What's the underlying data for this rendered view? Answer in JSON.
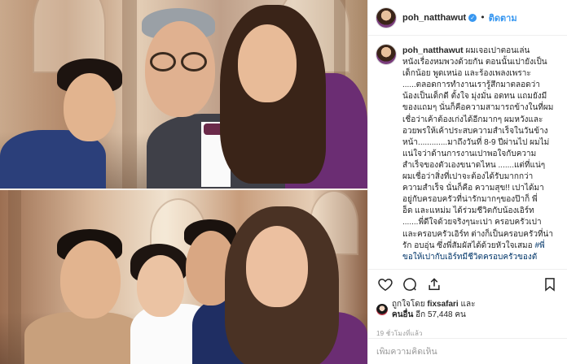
{
  "post": {
    "username": "poh_natthawut",
    "follow_label": "ติดตาม",
    "verified_mark": "✓",
    "separator": "•"
  },
  "caption": {
    "username": "poh_natthawut",
    "lines": [
      "ผมเจอเปาตอนเล่น",
      "หนังเรื่องหมพวงด้วยกัน ตอนนั้นเปายังเป็น",
      "เด็กน้อย พูดเหน่อ และร้องเพลงเพราะ",
      "......ตลอดการทำงานเรารู้สึกมาตลอดว่า",
      "น้องเป็นเด็กดี ตั้งใจ มุ่งมั่น อดทน แถมยังมี",
      "ของแถมๆ นั่นก็คือความสามารถข้างในที่ผม",
      "เชื่อว่าเค้าต้องเก่งได้อีกมากๆ ผมหวังและ",
      "อวยพรให้เค้าประสบความสำเร็จในวันข้าง",
      "หน้า.............มาถึงวันที่ 8-9 ปีผ่านไป ผมไม่",
      "แน่ใจว่าด้านการงานเปาพอใจกับความ",
      "สำเร็จของตัวเองขนาดไหน .......แต่ที่แน่ๆ",
      "ผมเชื่อว่าสิ่งที่เปาจะต้องได้รับมากกว่า",
      "ความสำเร็จ นั่นก็คือ ความสุข!! เปาได้มา",
      "อยู่กับครอบครัวที่น่ารักมากๆของป๊าก็ พี่",
      "อ็ด และแหม่ม ได้ร่วมชีวิตกับน้องเอิร์ท",
      ".......พี่ดีใจด้วยจริงๆนะเปา ครอบครัวเปา",
      "และครอบครัวเอิร์ท ต่างก็เป็นครอบครัวที่น่า",
      "รัก อบอุ่น ซึ่งพี่สัมผัสได้ด้วยหัวใจเสมอ"
    ],
    "hashtag_inline": "#พี่",
    "last_line": "ขอให้เปากับเอิร์ทมีชีวิตครอบครัวของตั"
  },
  "actions": {
    "like_icon": "heart-outline-icon",
    "comment_icon": "comment-icon",
    "share_icon": "share-icon",
    "save_icon": "bookmark-icon"
  },
  "likes": {
    "prefix": "ถูกใจโดย",
    "user": "fixsafari",
    "and": "และ",
    "others_prefix": "คนอื่น",
    "others_count": "อีก 57,448 คน"
  },
  "timestamp": "19 ชั่วโมงที่แล้ว",
  "add_comment": {
    "placeholder": "เพิ่มความคิดเห็น"
  },
  "colors": {
    "accent": "#3897f0",
    "text": "#262626",
    "muted": "#999999",
    "border": "#efefef"
  }
}
